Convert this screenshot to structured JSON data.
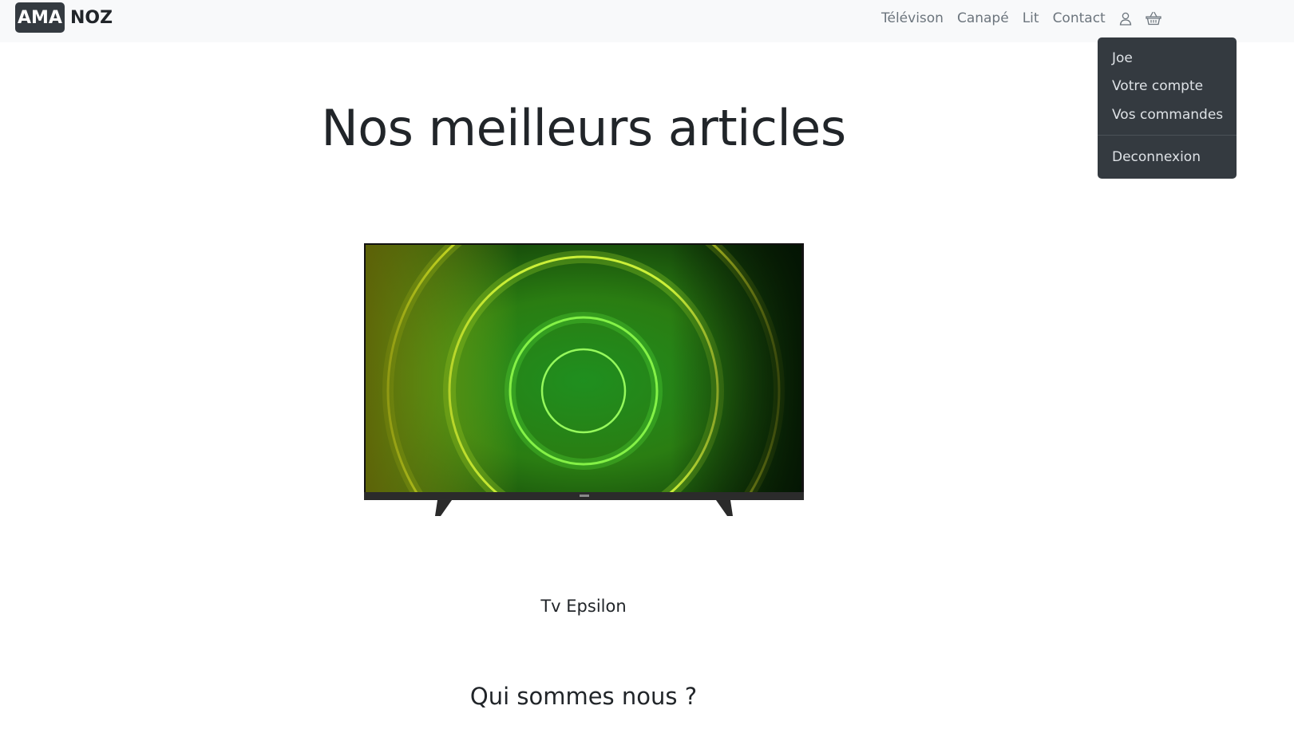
{
  "brand": {
    "part1": "AMA",
    "part2": "NOZ"
  },
  "nav": {
    "links": [
      "Télévison",
      "Canapé",
      "Lit",
      "Contact"
    ],
    "account_icon": "user-icon",
    "cart_icon": "basket-icon"
  },
  "account_menu": {
    "username": "Joe",
    "items": [
      "Votre compte",
      "Vos commandes"
    ],
    "logout": "Deconnexion"
  },
  "main": {
    "title": "Nos meilleurs articles",
    "featured_product": {
      "name": "Tv Epsilon",
      "image": "television-image"
    },
    "about_title": "Qui sommes nous ?"
  },
  "colors": {
    "navbar_bg": "#f8f9fa",
    "dropdown_bg": "#343a40",
    "brand_box": "#343a40",
    "nav_text": "#6c757d"
  }
}
